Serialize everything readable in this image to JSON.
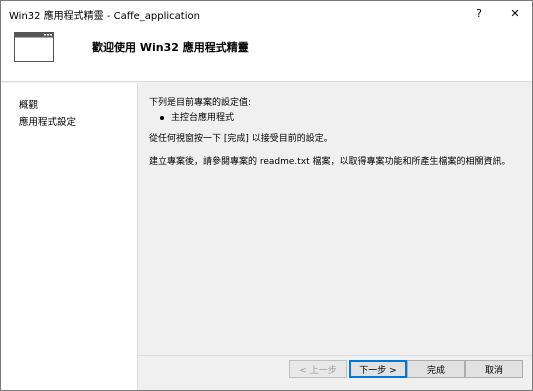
{
  "window": {
    "title": "Win32 應用程式精靈 - Caffe_application",
    "help_glyph": "?",
    "close_glyph": "✕"
  },
  "header": {
    "title": "歡迎使用 Win32 應用程式精靈",
    "icon": "window-icon"
  },
  "sidebar": {
    "items": [
      {
        "label": "概觀"
      },
      {
        "label": "應用程式設定"
      }
    ]
  },
  "main": {
    "intro": "下列是目前專案的設定值:",
    "bullets": [
      "主控台應用程式"
    ],
    "finish_hint": "從任何視窗按一下 [完成] 以接受目前的設定。",
    "after_hint": "建立專案後，請參閱專案的 readme.txt 檔案，以取得專案功能和所產生檔案的相關資訊。"
  },
  "buttons": {
    "prev": "< 上一步",
    "next": "下一步 >",
    "finish": "完成",
    "cancel": "取消"
  },
  "colors": {
    "accent": "#0078d7",
    "panel": "#f0f0f0",
    "white": "#ffffff"
  }
}
